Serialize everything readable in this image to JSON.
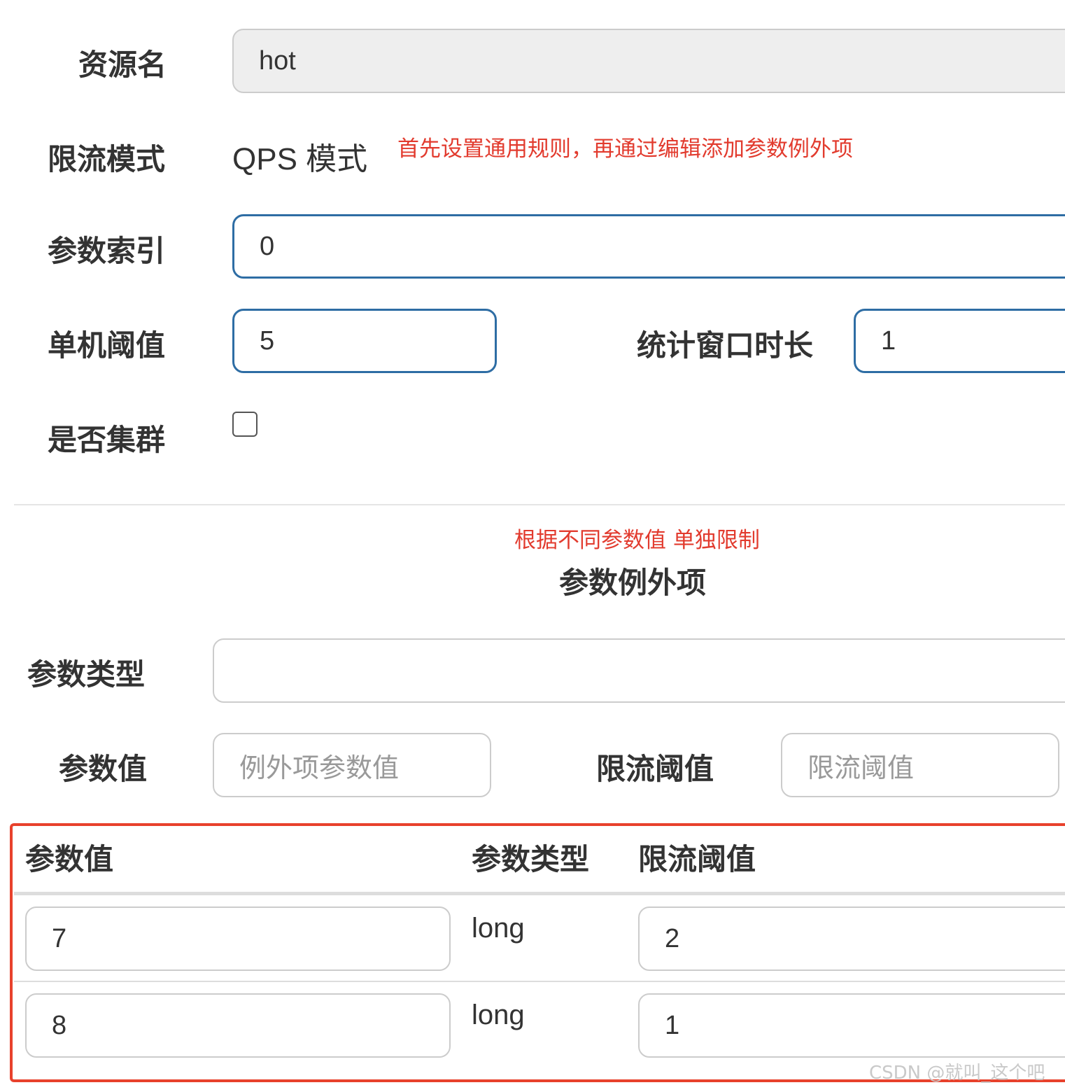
{
  "form": {
    "resource_name": {
      "label": "资源名",
      "value": "hot"
    },
    "flow_mode": {
      "label": "限流模式",
      "value": "QPS 模式"
    },
    "param_index": {
      "label": "参数索引",
      "value": "0"
    },
    "threshold": {
      "label": "单机阈值",
      "value": "5"
    },
    "stat_window": {
      "label": "统计窗口时长",
      "value": "1"
    },
    "cluster": {
      "label": "是否集群",
      "checked": false
    }
  },
  "annotations": {
    "general_rule_note": "首先设置通用规则，再通过编辑添加参数例外项",
    "exception_note": "根据不同参数值 单独限制"
  },
  "exceptions": {
    "title": "参数例外项",
    "param_type": {
      "label": "参数类型",
      "value": ""
    },
    "param_value": {
      "label": "参数值",
      "placeholder": "例外项参数值"
    },
    "limit_threshold": {
      "label": "限流阈值",
      "placeholder": "限流阈值"
    },
    "table": {
      "columns": [
        "参数值",
        "参数类型",
        "限流阈值"
      ],
      "rows": [
        {
          "value": "7",
          "type": "long",
          "threshold": "2"
        },
        {
          "value": "8",
          "type": "long",
          "threshold": "1"
        }
      ]
    }
  },
  "watermark": "CSDN @就叫_这个吧",
  "colors": {
    "focus_border": "#2e6da4",
    "annotation_red": "#e23b2e",
    "highlight_box": "#e8412c"
  }
}
